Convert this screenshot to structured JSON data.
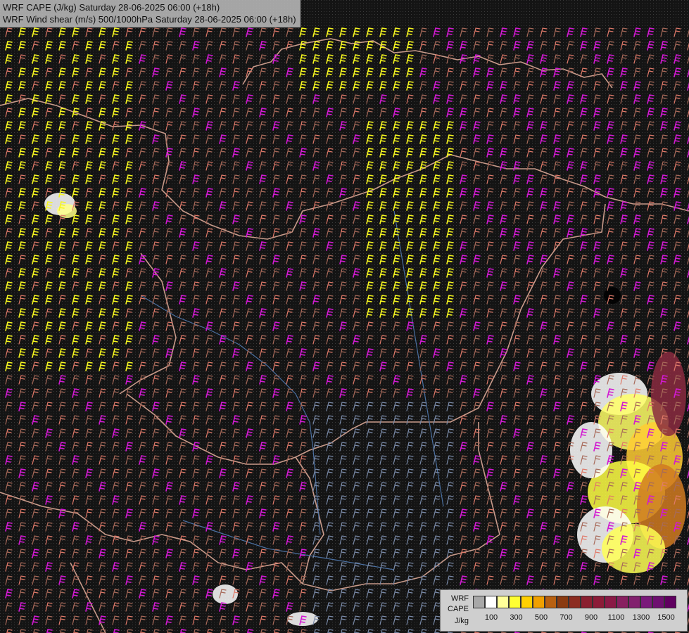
{
  "header": {
    "line1": "WRF CAPE (J/kg) Saturday 28-06-2025 06:00 (+18h)",
    "line2": "WRF Wind shear (m/s) 500/1000hPa Saturday 28-06-2025 06:00 (+18h)"
  },
  "legend": {
    "label_line1": "WRF",
    "label_line2": "CAPE",
    "label_line3": "J/kg",
    "colors": [
      "#a8a8a8",
      "#ffffff",
      "#ffff99",
      "#ffff33",
      "#ffd000",
      "#f0a000",
      "#b86010",
      "#8a3a10",
      "#8c2c20",
      "#8a2030",
      "#8c1c38",
      "#8a1a46",
      "#882060",
      "#82206e",
      "#7a1a7a",
      "#6e1070",
      "#600060"
    ],
    "tick_labels": [
      "100",
      "300",
      "500",
      "700",
      "900",
      "1100",
      "1300",
      "1500"
    ]
  },
  "colors": {
    "background": "#121212",
    "border": "#c89a8a",
    "river": "#4a6fa0",
    "barb_magenta": "#d21ad2",
    "barb_yellow": "#f5f520",
    "barb_salmon": "#e07a6a",
    "barb_brown": "#a86a5a",
    "barb_slate": "#7a8aa8"
  }
}
